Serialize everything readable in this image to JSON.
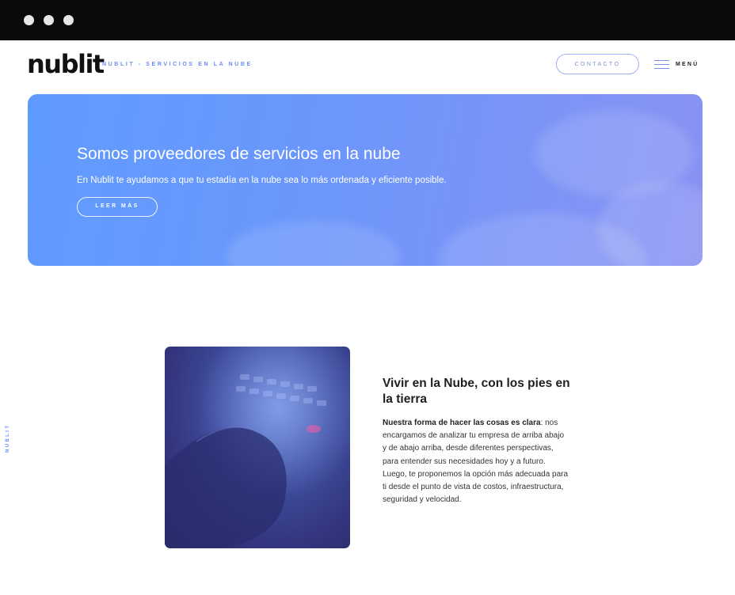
{
  "window": {
    "controls": [
      "close-dot",
      "minimize-dot",
      "maximize-dot"
    ]
  },
  "header": {
    "logo_text": "nublit",
    "tagline": "NUBLIT - SERVICIOS EN LA NUBE",
    "contact_label": "CONTACTO",
    "menu_label": "MENÚ",
    "menu_icon": "hamburger-icon"
  },
  "hero": {
    "title": "Somos proveedores de servicios en la nube",
    "subtitle": "En Nublit te ayudamos a que tu estadía en la nube sea lo más ordenada y eficiente posible.",
    "button_label": "LEER MÁS",
    "gradient_start": "#5f9bff",
    "gradient_end": "#8a92f3"
  },
  "side_label": "NUBLIT",
  "feature": {
    "title": "Vivir en la Nube, con los pies en la tierra",
    "lead": "Nuestra forma de hacer las cosas es clara",
    "body": ": nos encargamos de analizar tu empresa de arriba abajo y de abajo arriba, desde diferentes perspectivas, para entender sus necesidades hoy y a futuro. Luego, te proponemos la opción más adecuada para ti desde el punto de vista de costos, infraestructura, seguridad y velocidad."
  },
  "colors": {
    "accent": "#6b8cf6",
    "chrome": "#0a0a0a"
  }
}
